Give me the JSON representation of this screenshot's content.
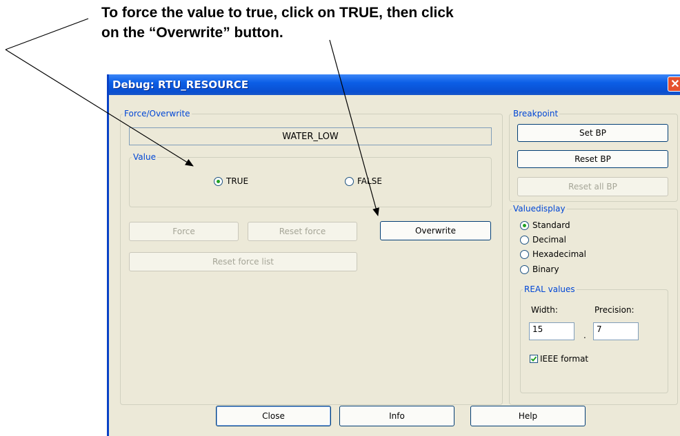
{
  "annotation": {
    "line1": "To force the value to true, click on TRUE, then click",
    "line2": "on the “Overwrite” button."
  },
  "window": {
    "title": "Debug: RTU_RESOURCE",
    "close_glyph": "✕"
  },
  "force_overwrite": {
    "legend": "Force/Overwrite",
    "variable_name": "WATER_LOW",
    "value_legend": "Value",
    "true_label": "TRUE",
    "false_label": "FALSE",
    "selected": "TRUE",
    "force_label": "Force",
    "reset_force_label": "Reset force",
    "overwrite_label": "Overwrite",
    "reset_force_list_label": "Reset force list"
  },
  "breakpoint": {
    "legend": "Breakpoint",
    "set_label": "Set BP",
    "reset_label": "Reset BP",
    "reset_all_label": "Reset all BP"
  },
  "valuedisplay": {
    "legend": "Valuedisplay",
    "options": [
      "Standard",
      "Decimal",
      "Hexadecimal",
      "Binary"
    ],
    "selected": "Standard",
    "real_legend": "REAL values",
    "width_label": "Width:",
    "precision_label": "Precision:",
    "width_value": "15",
    "separator": ".",
    "precision_value": "7",
    "ieee_label": "IEEE format",
    "ieee_checked": true
  },
  "footer": {
    "close_label": "Close",
    "info_label": "Info",
    "help_label": "Help"
  },
  "colors": {
    "titlebar": "#0b5ee6",
    "dialog_bg": "#ece9d8",
    "legend_text": "#0046d5",
    "radio_dot": "#21a121"
  }
}
